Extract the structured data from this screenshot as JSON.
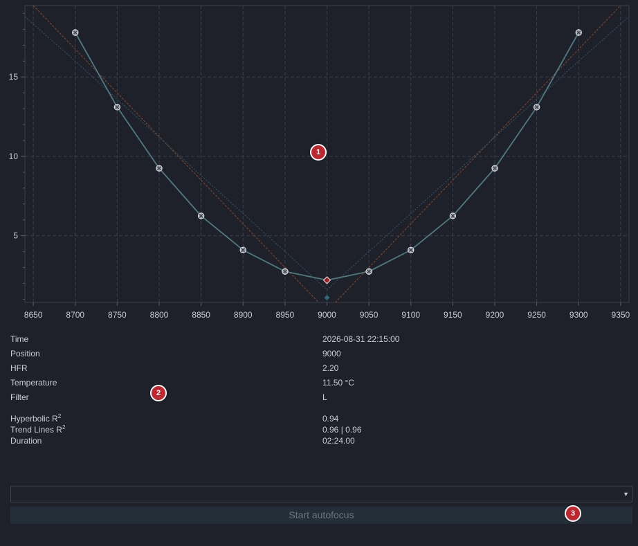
{
  "chart_data": {
    "type": "line",
    "title": "",
    "xlabel": "",
    "ylabel": "",
    "xlim": [
      8640,
      9360
    ],
    "ylim": [
      0.8,
      19.5
    ],
    "xticks": [
      8650,
      8700,
      8750,
      8800,
      8850,
      8900,
      8950,
      9000,
      9050,
      9100,
      9150,
      9200,
      9250,
      9300,
      9350
    ],
    "yticks": [
      5,
      10,
      15
    ],
    "grid": true,
    "series": [
      {
        "role": "measurements",
        "color": "#4f7a80",
        "x": [
          8700,
          8750,
          8800,
          8850,
          8900,
          8950,
          9000,
          9050,
          9100,
          9150,
          9200,
          9250,
          9300
        ],
        "y": [
          17.8,
          13.1,
          9.25,
          6.25,
          4.1,
          2.75,
          2.2,
          2.75,
          4.1,
          6.25,
          9.25,
          13.1,
          17.8
        ]
      },
      {
        "role": "hyperbolic-fit",
        "color": "#2e5a6a",
        "x": [
          8640,
          8700,
          8750,
          8800,
          8850,
          8900,
          8950,
          8975,
          9000,
          9025,
          9050,
          9100,
          9150,
          9200,
          9250,
          9300,
          9360
        ],
        "y": [
          18.8,
          16.0,
          13.6,
          11.2,
          8.8,
          6.4,
          4.0,
          2.8,
          1.6,
          2.8,
          4.0,
          6.4,
          8.8,
          11.2,
          13.6,
          16.0,
          18.8
        ]
      },
      {
        "role": "trend-left",
        "color": "#8a4a2a",
        "x": [
          8650,
          8990
        ],
        "y": [
          19.5,
          0.8
        ]
      },
      {
        "role": "trend-right",
        "color": "#8a4a2a",
        "x": [
          9010,
          9350
        ],
        "y": [
          0.8,
          19.5
        ]
      }
    ],
    "highlight": {
      "x": 9000,
      "y": 2.2,
      "color": "#a0201e"
    },
    "fit_minimum": {
      "x": 9000,
      "y": 1.1
    }
  },
  "info": {
    "time_label": "Time",
    "time_value": "2026-08-31 22:15:00",
    "position_label": "Position",
    "position_value": "9000",
    "hfr_label": "HFR",
    "hfr_value": "2.20",
    "temperature_label": "Temperature",
    "temperature_value": "11.50 °C",
    "filter_label": "Filter",
    "filter_value": "L",
    "hyperbolic_label": "Hyperbolic R",
    "hyperbolic_value": "0.94",
    "trend_label": "Trend Lines R",
    "trend_value": "0.96 | 0.96",
    "duration_label": "Duration",
    "duration_value": "02:24.00",
    "r_squared_sup": "2"
  },
  "controls": {
    "dropdown_value": "",
    "start_label": "Start autofocus"
  },
  "badges": [
    "1",
    "2",
    "3"
  ]
}
